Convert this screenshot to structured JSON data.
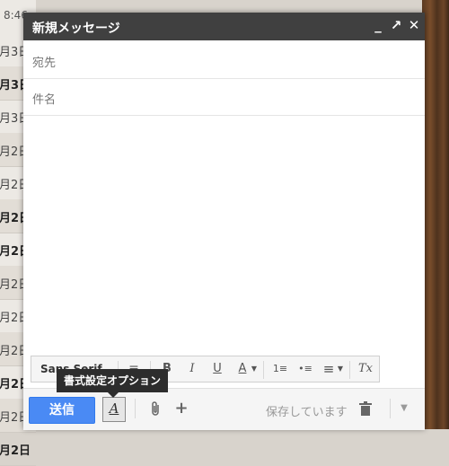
{
  "background_list": {
    "time": "8:46",
    "rows": [
      {
        "date": "月3日",
        "bold": false
      },
      {
        "date": "月3日",
        "bold": true
      },
      {
        "date": "月3日",
        "bold": false
      },
      {
        "date": "月2日",
        "bold": false
      },
      {
        "date": "月2日",
        "bold": false
      },
      {
        "date": "月2日",
        "bold": true
      },
      {
        "date": "月2日",
        "bold": true
      },
      {
        "date": "月2日",
        "bold": false
      },
      {
        "date": "月2日",
        "bold": false
      },
      {
        "date": "月2日",
        "bold": false
      },
      {
        "date": "月2日",
        "bold": true
      },
      {
        "date": "月2日",
        "bold": false
      },
      {
        "date": "月2日",
        "bold": true
      }
    ]
  },
  "compose": {
    "title": "新規メッセージ",
    "controls": {
      "minimize": "_",
      "popout": "↗",
      "close": "✕"
    },
    "to_label": "宛先",
    "subject_label": "件名",
    "toolbar": {
      "font": "Sans Serif",
      "bold": "B",
      "italic": "I",
      "underline": "U",
      "text_color": "A",
      "numbered_list": "1≡",
      "bulleted_list": "•≡",
      "align": "≡",
      "remove_format": "Tx"
    },
    "send_label": "送信",
    "format_toggle": "A",
    "attach_icon": "paperclip-icon",
    "insert_label": "+",
    "saving_status": "保存しています",
    "tooltip": "書式設定オプション"
  },
  "colors": {
    "send_button": "#4a8af4",
    "title_bar": "#404040",
    "tooltip": "#2d2d2d"
  }
}
